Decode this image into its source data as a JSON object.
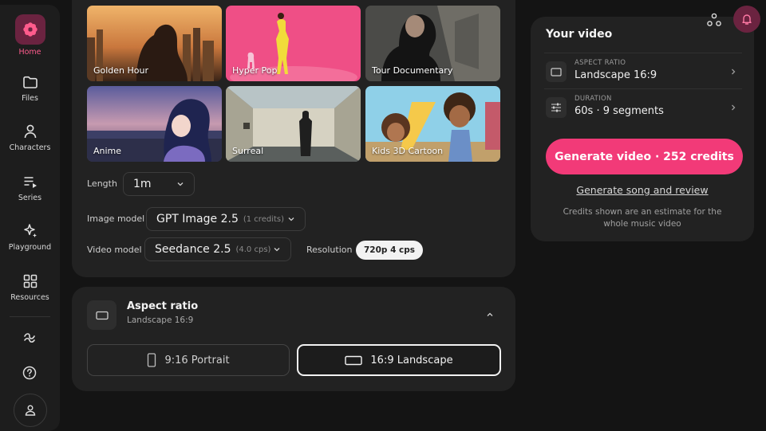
{
  "sidebar": {
    "items": [
      {
        "label": "Home",
        "icon": "flower-icon"
      },
      {
        "label": "Files",
        "icon": "folder-icon"
      },
      {
        "label": "Characters",
        "icon": "person-icon"
      },
      {
        "label": "Series",
        "icon": "playlist-icon"
      },
      {
        "label": "Playground",
        "icon": "sparkle-icon"
      },
      {
        "label": "Resources",
        "icon": "grid-icon"
      }
    ],
    "bottom": [
      "squiggle-icon",
      "help-icon",
      "account-icon"
    ],
    "accent": "#ff5c8d"
  },
  "styles": [
    {
      "label": "Golden Hour"
    },
    {
      "label": "Hyper Pop"
    },
    {
      "label": "Tour Documentary"
    },
    {
      "label": "Anime"
    },
    {
      "label": "Surreal"
    },
    {
      "label": "Kids 3D Cartoon"
    }
  ],
  "settings": {
    "length_label": "Length",
    "length_value": "1m",
    "image_model_label": "Image model",
    "image_model_value": "GPT Image 2.5",
    "image_model_cost": "(1 credits)",
    "video_model_label": "Video model",
    "video_model_value": "Seedance 2.5",
    "video_model_cost": "(4.0 cps)",
    "resolution_label": "Resolution",
    "resolution_value": "720p 4 cps"
  },
  "aspect": {
    "title": "Aspect ratio",
    "subtitle": "Landscape 16:9",
    "options": [
      {
        "label": "9:16 Portrait",
        "selected": false
      },
      {
        "label": "16:9 Landscape",
        "selected": true
      }
    ]
  },
  "panel": {
    "title": "Your video",
    "rows": [
      {
        "caption": "ASPECT RATIO",
        "value": "Landscape 16:9",
        "icon": "rectangle-icon"
      },
      {
        "caption": "DURATION",
        "value": "60s · 9 segments",
        "icon": "sliders-icon"
      }
    ],
    "generate_label": "Generate video · 252 credits",
    "song_link": "Generate song and review",
    "note": "Credits shown are an estimate for the whole music video",
    "accent": "#f23a78"
  }
}
